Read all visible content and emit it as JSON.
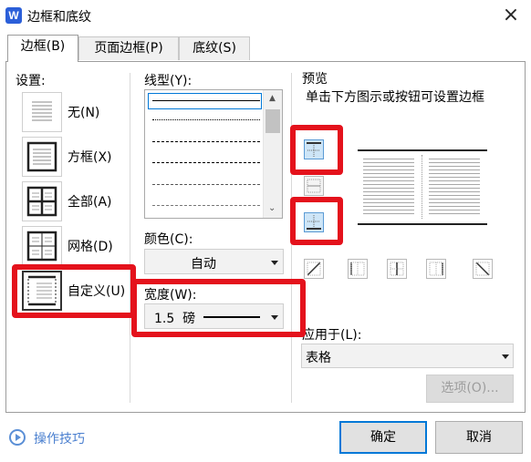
{
  "window": {
    "title": "边框和底纹",
    "app_icon": "W"
  },
  "tabs": [
    {
      "label": "边框(B)",
      "active": true
    },
    {
      "label": "页面边框(P)",
      "active": false
    },
    {
      "label": "底纹(S)",
      "active": false
    }
  ],
  "settings": {
    "label": "设置:",
    "items": [
      {
        "label": "无(N)",
        "icon": "border-none-icon"
      },
      {
        "label": "方框(X)",
        "icon": "border-box-icon"
      },
      {
        "label": "全部(A)",
        "icon": "border-all-icon"
      },
      {
        "label": "网格(D)",
        "icon": "border-grid-icon"
      },
      {
        "label": "自定义(U)",
        "icon": "border-custom-icon",
        "selected": true
      }
    ]
  },
  "line_style": {
    "label": "线型(Y):"
  },
  "color": {
    "label": "颜色(C):",
    "value": "自动"
  },
  "width": {
    "label": "宽度(W):",
    "value": "1.5  磅"
  },
  "preview": {
    "label": "预览",
    "hint": "单击下方图示或按钮可设置边框"
  },
  "apply_to": {
    "label": "应用于(L):",
    "value": "表格"
  },
  "options_button": "选项(O)...",
  "tips_link": "操作技巧",
  "ok_button": "确定",
  "cancel_button": "取消",
  "colors": {
    "accent": "#0078d7",
    "highlight": "#e4121c",
    "icon_blue": "#2b5fd9"
  }
}
